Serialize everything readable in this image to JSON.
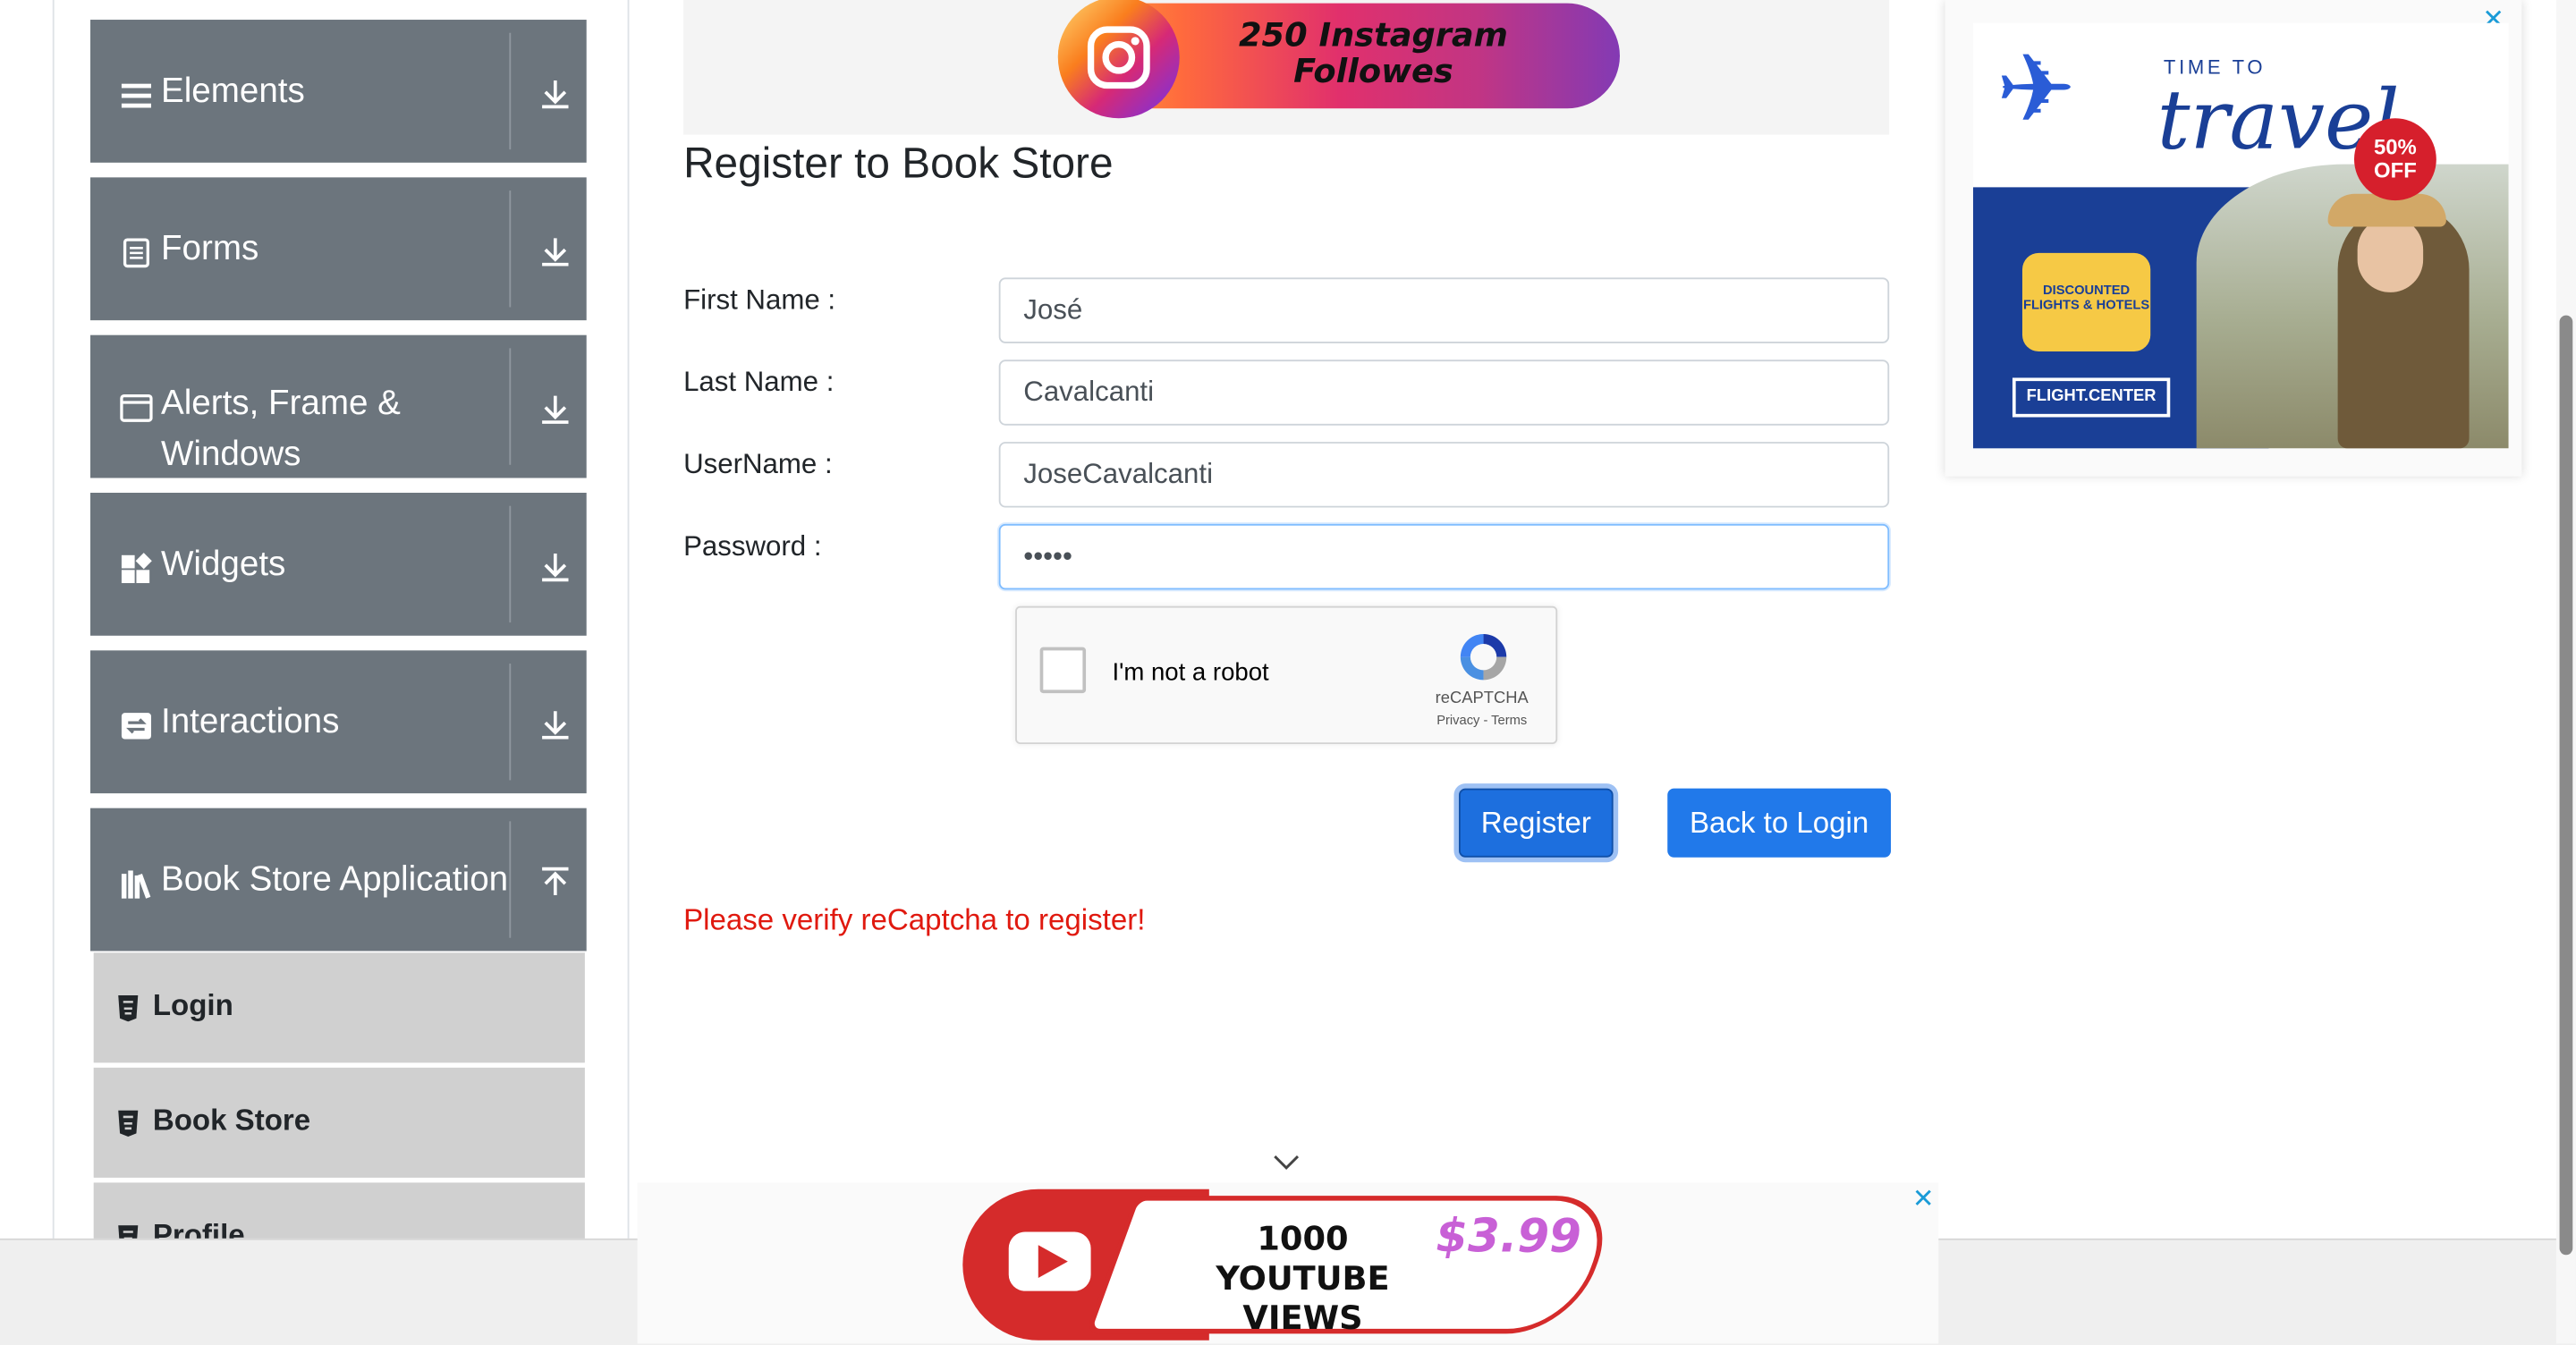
{
  "sidebar": {
    "groups": [
      {
        "label": "Elements",
        "icon": "hamburger-icon",
        "arrow": "download-arrow-icon"
      },
      {
        "label": "Forms",
        "icon": "document-icon",
        "arrow": "download-arrow-icon"
      },
      {
        "label": "Alerts, Frame & Windows",
        "icon": "window-icon",
        "arrow": "download-arrow-icon"
      },
      {
        "label": "Widgets",
        "icon": "widgets-icon",
        "arrow": "download-arrow-icon"
      },
      {
        "label": "Interactions",
        "icon": "interactions-icon",
        "arrow": "download-arrow-icon"
      },
      {
        "label": "Book Store Application",
        "icon": "books-icon",
        "arrow": "upload-arrow-icon"
      }
    ],
    "subitems": [
      {
        "label": "Login",
        "icon": "html5-icon"
      },
      {
        "label": "Book Store",
        "icon": "html5-icon"
      },
      {
        "label": "Profile",
        "icon": "html5-icon"
      }
    ]
  },
  "ads": {
    "top_banner": {
      "line1": "250 Instagram",
      "line2": "Followes"
    },
    "right": {
      "close": "✕",
      "time_to": "TIME TO",
      "travel": "travel",
      "badge_line1": "50%",
      "badge_line2": "OFF",
      "deal_line1": "DISCOUNTED",
      "deal_line2": "FLIGHTS & HOTELS",
      "brand": "FLIGHT.CENTER"
    },
    "bottom": {
      "close": "✕",
      "line1": "1000",
      "line2": "YOUTUBE VIEWS",
      "price": "$3.99"
    }
  },
  "form": {
    "title": "Register to Book Store",
    "fields": [
      {
        "label": "First Name :",
        "value": "José"
      },
      {
        "label": "Last Name :",
        "value": "Cavalcanti"
      },
      {
        "label": "UserName :",
        "value": "JoseCavalcanti"
      },
      {
        "label": "Password :",
        "value": "•••••"
      }
    ],
    "captcha": {
      "checkbox_label": "I'm not a robot",
      "brand": "reCAPTCHA",
      "links": "Privacy - Terms"
    },
    "register_button": "Register",
    "back_button": "Back to Login",
    "error": "Please verify reCaptcha to register!"
  },
  "colors": {
    "sidebar_group": "#6c757d",
    "sidebar_sub": "#d0d0d0",
    "button": "#1a73e8",
    "error": "#e0190f"
  }
}
